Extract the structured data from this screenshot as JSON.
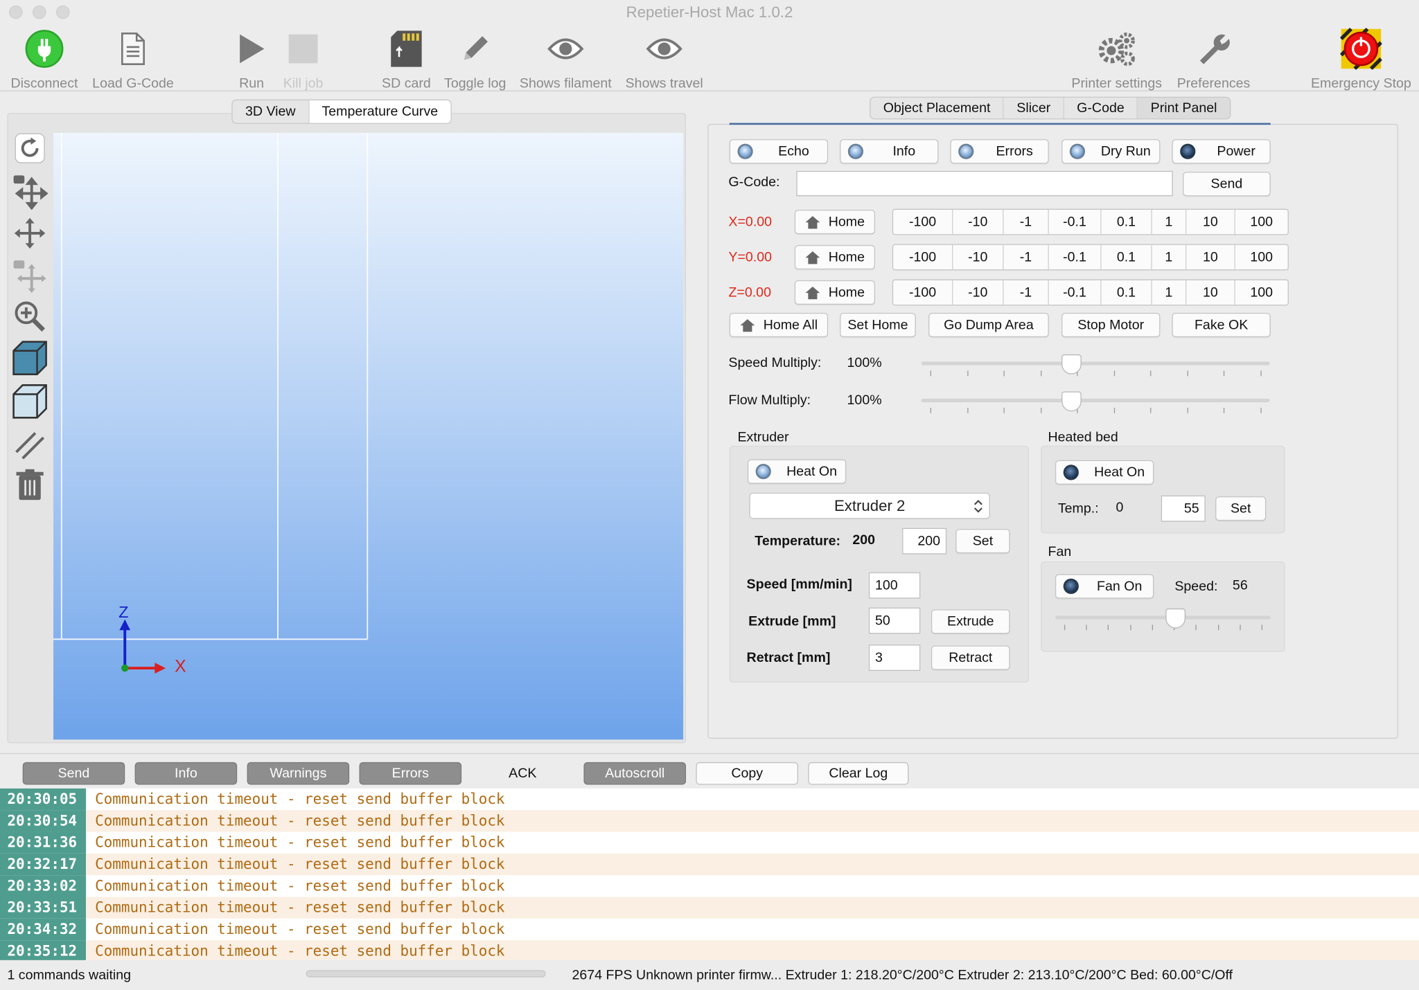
{
  "window": {
    "title": "Repetier-Host Mac 1.0.2"
  },
  "toolbar": {
    "disconnect": "Disconnect",
    "load_gcode": "Load G-Code",
    "run": "Run",
    "kill_job": "Kill job",
    "sd_card": "SD card",
    "toggle_log": "Toggle log",
    "shows_filament": "Shows filament",
    "shows_travel": "Shows travel",
    "printer_settings": "Printer settings",
    "preferences": "Preferences",
    "emergency_stop": "Emergency Stop"
  },
  "view_tabs": [
    "3D View",
    "Temperature Curve"
  ],
  "axes": {
    "z": "Z",
    "x": "X"
  },
  "right_tabs": [
    "Object Placement",
    "Slicer",
    "G-Code",
    "Print Panel"
  ],
  "toggles": [
    "Echo",
    "Info",
    "Errors",
    "Dry Run",
    "Power"
  ],
  "gcode": {
    "label": "G-Code:",
    "value": "",
    "send": "Send"
  },
  "positions": {
    "x": "X=0.00",
    "y": "Y=0.00",
    "z": "Z=0.00"
  },
  "home_label": "Home",
  "jog_steps": [
    "-100",
    "-10",
    "-1",
    "-0.1",
    "0.1",
    "1",
    "10",
    "100"
  ],
  "actions": [
    "Home All",
    "Set Home",
    "Go Dump Area",
    "Stop Motor",
    "Fake OK"
  ],
  "speed_multiply": {
    "label": "Speed Multiply:",
    "value": "100%",
    "level": 0.43
  },
  "flow_multiply": {
    "label": "Flow Multiply:",
    "value": "100%",
    "level": 0.43
  },
  "extruder": {
    "title": "Extruder",
    "heat_on": "Heat On",
    "selected": "Extruder 2",
    "temperature_label": "Temperature:",
    "temperature_current": "200",
    "temperature_target": "200",
    "set": "Set",
    "speed_label": "Speed [mm/min]",
    "speed_value": "100",
    "extrude_label": "Extrude [mm]",
    "extrude_value": "50",
    "extrude_button": "Extrude",
    "retract_label": "Retract [mm]",
    "retract_value": "3",
    "retract_button": "Retract"
  },
  "heated_bed": {
    "title": "Heated bed",
    "heat_on": "Heat On",
    "temp_label": "Temp.:",
    "temp_current": "0",
    "temp_target": "55",
    "set": "Set"
  },
  "fan": {
    "title": "Fan",
    "fan_on": "Fan On",
    "speed_label": "Speed:",
    "speed_value": "56",
    "level": 0.56
  },
  "log_tabs": [
    "Send",
    "Info",
    "Warnings",
    "Errors",
    "ACK",
    "Autoscroll",
    "Copy",
    "Clear Log"
  ],
  "log": [
    {
      "time": "20:30:05",
      "msg": "Communication timeout - reset send buffer block"
    },
    {
      "time": "20:30:54",
      "msg": "Communication timeout - reset send buffer block"
    },
    {
      "time": "20:31:36",
      "msg": "Communication timeout - reset send buffer block"
    },
    {
      "time": "20:32:17",
      "msg": "Communication timeout - reset send buffer block"
    },
    {
      "time": "20:33:02",
      "msg": "Communication timeout - reset send buffer block"
    },
    {
      "time": "20:33:51",
      "msg": "Communication timeout - reset send buffer block"
    },
    {
      "time": "20:34:32",
      "msg": "Communication timeout - reset send buffer block"
    },
    {
      "time": "20:35:12",
      "msg": "Communication timeout - reset send buffer block"
    }
  ],
  "status": {
    "waiting": "1 commands waiting",
    "info": "2674 FPS Unknown printer firmw... Extruder 1: 218.20°C/200°C Extruder 2: 213.10°C/200°C Bed: 60.00°C/Off"
  },
  "colors": {
    "accent_green": "#3cc83c",
    "position_red": "#e0281b",
    "log_time_bg": "#4f9d8e",
    "log_msg": "#b06a12"
  },
  "icons": [
    "power-icon",
    "document-icon",
    "play-icon",
    "stop-icon",
    "sd-card-icon",
    "pencil-icon",
    "eye-icon",
    "gears-icon",
    "wrench-icon",
    "emergency-stop-icon",
    "refresh-icon",
    "move-icon",
    "zoom-icon",
    "cube-icon",
    "trash-icon",
    "home-icon"
  ]
}
